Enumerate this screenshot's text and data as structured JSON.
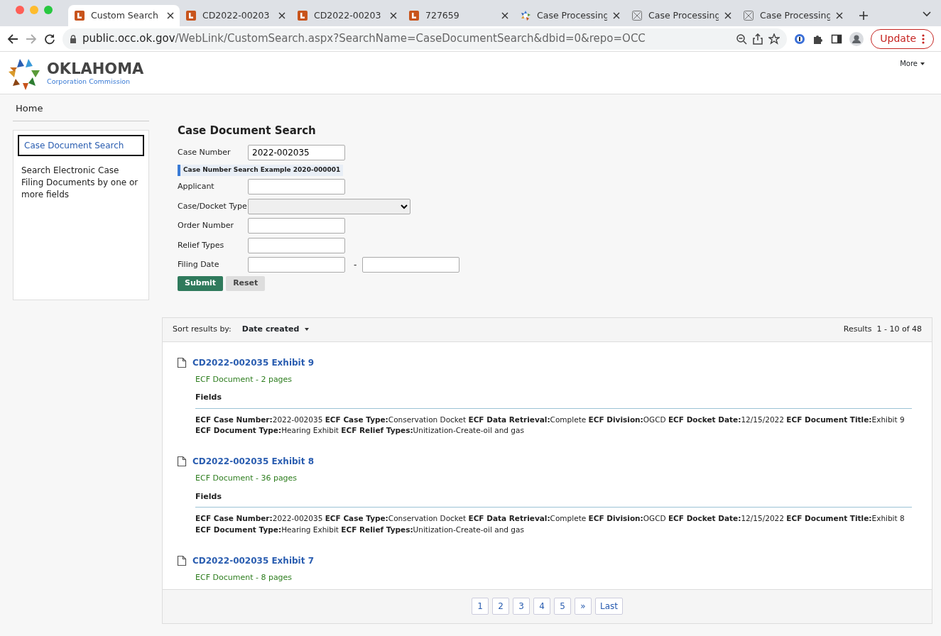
{
  "browser": {
    "tabs": [
      {
        "label": "Custom Search",
        "kind": "letter",
        "selected": true
      },
      {
        "label": "CD2022-00203",
        "kind": "letter",
        "selected": false
      },
      {
        "label": "CD2022-00203",
        "kind": "letter",
        "selected": false
      },
      {
        "label": "727659",
        "kind": "letter",
        "selected": false
      },
      {
        "label": "Case Processing",
        "kind": "star",
        "selected": false
      },
      {
        "label": "Case Processing",
        "kind": "generic",
        "selected": false
      },
      {
        "label": "Case Processing",
        "kind": "generic",
        "selected": false
      }
    ],
    "url_host": "public.occ.ok.gov",
    "url_path": "/WebLink/CustomSearch.aspx?SearchName=CaseDocumentSearch&dbid=0&repo=OCC",
    "update_label": "Update"
  },
  "header": {
    "logo_title": "OKLAHOMA",
    "logo_subtitle": "Corporation Commission",
    "more_menu": "More"
  },
  "breadcrumb": "Home",
  "sidebar": {
    "items": [
      {
        "label": "Case Document Search",
        "selected": true
      }
    ],
    "description": "Search Electronic Case Filing Documents by one or more fields"
  },
  "form": {
    "title": "Case Document Search",
    "fields": [
      {
        "label": "Case Number",
        "kind": "text",
        "value": "2022-002035",
        "hint": "Case Number Search Example 2020-000001"
      },
      {
        "label": "Applicant",
        "kind": "text"
      },
      {
        "label": "Case/Docket Type",
        "kind": "select"
      },
      {
        "label": "Order Number",
        "kind": "text"
      },
      {
        "label": "Relief Types",
        "kind": "text"
      },
      {
        "label": "Filing Date",
        "kind": "range",
        "separator": "-"
      }
    ],
    "buttons": [
      {
        "label": "Submit",
        "kind": "primary"
      },
      {
        "label": "Reset",
        "kind": "secondary"
      }
    ]
  },
  "results": {
    "sort_label": "Sort results by:",
    "sort_value": "Date created",
    "summary": "Results  1 - 10 of 48",
    "items": [
      {
        "title": "CD2022-002035 Exhibit 9",
        "subtitle": "ECF Document - 2 pages",
        "fields_heading": "Fields",
        "fields": "**ECF Case Number:**2022-002035 **ECF Case Type:**Conservation Docket **ECF Data Retrieval:**Complete **ECF Division:**OGCD **ECF Docket Date:**12/15/2022 **ECF Document Title:**Exhibit 9 **ECF Document Type:**Hearing Exhibit **ECF Relief Types:**Unitization-Create-oil and gas"
      },
      {
        "title": "CD2022-002035 Exhibit 8",
        "subtitle": "ECF Document - 36 pages",
        "fields_heading": "Fields",
        "fields": "**ECF Case Number:**2022-002035 **ECF Case Type:**Conservation Docket **ECF Data Retrieval:**Complete **ECF Division:**OGCD **ECF Docket Date:**12/15/2022 **ECF Document Title:**Exhibit 8 **ECF Document Type:**Hearing Exhibit **ECF Relief Types:**Unitization-Create-oil and gas"
      },
      {
        "title": "CD2022-002035 Exhibit 7",
        "subtitle": "ECF Document - 8 pages"
      }
    ],
    "pages": [
      "1",
      "2",
      "3",
      "4",
      "5",
      "»",
      "Last"
    ]
  }
}
